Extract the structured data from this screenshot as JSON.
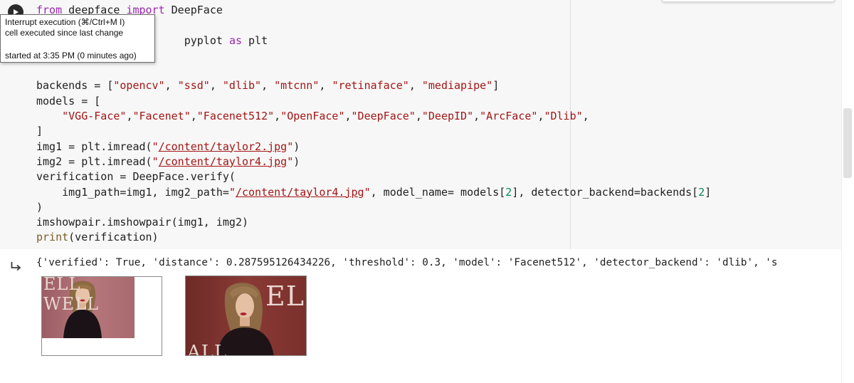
{
  "cell": {
    "code_lines": [
      [
        [
          "kw",
          "from"
        ],
        [
          "t",
          " "
        ],
        [
          "u",
          "deepface"
        ],
        [
          "t",
          " "
        ],
        [
          "kw",
          "import"
        ],
        [
          "t",
          " DeepFace"
        ]
      ],
      [
        [
          "t",
          ""
        ]
      ],
      [
        [
          "t",
          "                       pyplot "
        ],
        [
          "kw",
          "as"
        ],
        [
          "t",
          " plt"
        ]
      ],
      [
        [
          "t",
          ""
        ]
      ],
      [
        [
          "t",
          ""
        ]
      ],
      [
        [
          "t",
          "backends = ["
        ],
        [
          "str",
          "\"opencv\""
        ],
        [
          "t",
          ", "
        ],
        [
          "str",
          "\"ssd\""
        ],
        [
          "t",
          ", "
        ],
        [
          "str",
          "\"dlib\""
        ],
        [
          "t",
          ", "
        ],
        [
          "str",
          "\"mtcnn\""
        ],
        [
          "t",
          ", "
        ],
        [
          "str",
          "\"retinaface\""
        ],
        [
          "t",
          ", "
        ],
        [
          "str",
          "\"mediapipe\""
        ],
        [
          "t",
          "]"
        ]
      ],
      [
        [
          "t",
          "models = ["
        ]
      ],
      [
        [
          "t",
          "    "
        ],
        [
          "str",
          "\"VGG-Face\""
        ],
        [
          "t",
          ","
        ],
        [
          "str",
          "\"Facenet\""
        ],
        [
          "t",
          ","
        ],
        [
          "str",
          "\"Facenet512\""
        ],
        [
          "t",
          ","
        ],
        [
          "str",
          "\"OpenFace\""
        ],
        [
          "t",
          ","
        ],
        [
          "str",
          "\"DeepFace\""
        ],
        [
          "t",
          ","
        ],
        [
          "str",
          "\"DeepID\""
        ],
        [
          "t",
          ","
        ],
        [
          "str",
          "\"ArcFace\""
        ],
        [
          "t",
          ","
        ],
        [
          "str",
          "\"Dlib\""
        ],
        [
          "t",
          ","
        ]
      ],
      [
        [
          "t",
          "]"
        ]
      ],
      [
        [
          "t",
          "img1 = plt.imread("
        ],
        [
          "str",
          "\""
        ],
        [
          "link",
          "/content/taylor2.jpg"
        ],
        [
          "str",
          "\""
        ],
        [
          "t",
          ")"
        ]
      ],
      [
        [
          "t",
          "img2 = plt.imread("
        ],
        [
          "str",
          "\""
        ],
        [
          "link",
          "/content/taylor4.jpg"
        ],
        [
          "str",
          "\""
        ],
        [
          "t",
          ")"
        ]
      ],
      [
        [
          "t",
          "verification = DeepFace.verify("
        ]
      ],
      [
        [
          "t",
          "    img1_path=img1, img2_path="
        ],
        [
          "str",
          "\""
        ],
        [
          "link",
          "/content/taylor4.jpg"
        ],
        [
          "str",
          "\""
        ],
        [
          "t",
          ", model_name= models["
        ],
        [
          "num",
          "2"
        ],
        [
          "t",
          "], detector_backend=backends["
        ],
        [
          "num",
          "2"
        ],
        [
          "t",
          "]"
        ]
      ],
      [
        [
          "t",
          ")"
        ]
      ],
      [
        [
          "t",
          "imshowpair.imshowpair(img1, img2)"
        ]
      ],
      [
        [
          "builtin",
          "print"
        ],
        [
          "t",
          "(verification)"
        ]
      ]
    ]
  },
  "tooltip": {
    "line1": "Interrupt execution (⌘/Ctrl+M I)",
    "line2": "cell executed since last change",
    "line3": "started at 3:35 PM (0 minutes ago)"
  },
  "output": {
    "text": "{'verified': True, 'distance': 0.287595126434226, 'threshold': 0.3, 'model': 'Facenet512', 'detector_backend': 'dlib', 's"
  },
  "images": {
    "img1_wall_text": "ELL  WELL",
    "img2_wall_text_top": "ELL",
    "img2_wall_text_bottom": "ALL"
  },
  "colors": {
    "keyword": "#9c27b0",
    "string": "#a31515",
    "number": "#098658",
    "cell_bg": "#f7f7f7"
  },
  "icons": {
    "run": "stop-play-icon",
    "output": "output-arrow-icon"
  }
}
